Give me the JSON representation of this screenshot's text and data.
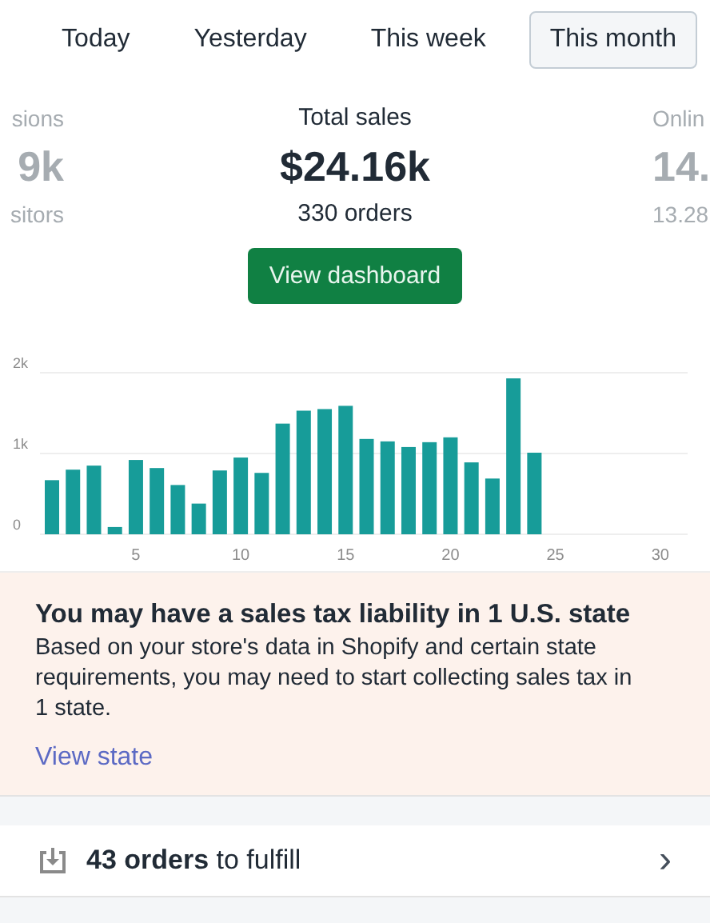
{
  "tabs": [
    {
      "label": "Today",
      "selected": false
    },
    {
      "label": "Yesterday",
      "selected": false
    },
    {
      "label": "This week",
      "selected": false
    },
    {
      "label": "This month",
      "selected": true
    }
  ],
  "stats": [
    {
      "label": "sions",
      "value": "9k",
      "detail": "sitors",
      "kind": "left"
    },
    {
      "label": "Total sales",
      "value": "$24.16k",
      "detail": "330 orders",
      "kind": "center"
    },
    {
      "label": "Onlin",
      "value": "14.",
      "detail": "13.28",
      "kind": "right"
    }
  ],
  "dashboard_button": "View dashboard",
  "chart_data": {
    "type": "bar",
    "x": [
      1,
      2,
      3,
      4,
      5,
      6,
      7,
      8,
      9,
      10,
      11,
      12,
      13,
      14,
      15,
      16,
      17,
      18,
      19,
      20,
      21,
      22,
      23,
      24
    ],
    "values": [
      670,
      800,
      850,
      90,
      920,
      820,
      610,
      380,
      790,
      950,
      760,
      1370,
      1530,
      1550,
      1590,
      1180,
      1150,
      1080,
      1140,
      1200,
      890,
      690,
      1930,
      1010
    ],
    "xlim": [
      1,
      31
    ],
    "ylim": [
      0,
      2000
    ],
    "xticks": [
      5,
      10,
      15,
      20,
      25,
      30
    ],
    "yticks": [
      {
        "value": 0,
        "label": "0"
      },
      {
        "value": 1000,
        "label": "1k"
      },
      {
        "value": 2000,
        "label": "2k"
      }
    ]
  },
  "banner": {
    "title": "You may have a sales tax liability in 1 U.S. state",
    "body": "Based on your store's data in Shopify and certain state requirements, you may need to start collecting sales tax in 1 state.",
    "link": "View state"
  },
  "task_row": {
    "text": "**43 orders** to fulfill",
    "chevron": "›"
  }
}
